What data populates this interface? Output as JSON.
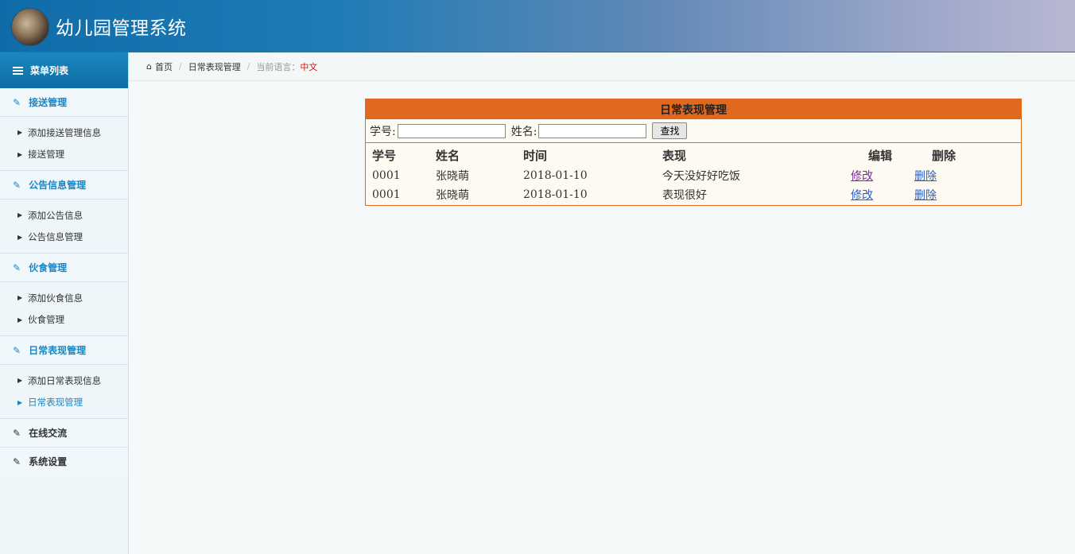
{
  "header": {
    "title": "幼儿园管理系统"
  },
  "sidebar": {
    "menu_title": "菜单列表",
    "groups": [
      {
        "title": "接送管理",
        "items": [
          "添加接送管理信息",
          "接送管理"
        ]
      },
      {
        "title": "公告信息管理",
        "items": [
          "添加公告信息",
          "公告信息管理"
        ]
      },
      {
        "title": "伙食管理",
        "items": [
          "添加伙食信息",
          "伙食管理"
        ]
      },
      {
        "title": "日常表现管理",
        "items": [
          "添加日常表现信息",
          "日常表现管理"
        ]
      }
    ],
    "extra": [
      "在线交流",
      "系统设置"
    ],
    "active_item": "日常表现管理"
  },
  "breadcrumb": {
    "home": "首页",
    "current": "日常表现管理",
    "lang_label": "当前语言：",
    "lang_value": "中文"
  },
  "panel": {
    "title": "日常表现管理",
    "search": {
      "id_label": "学号:",
      "name_label": "姓名:",
      "id_value": "",
      "name_value": "",
      "button": "查找"
    },
    "columns": [
      "学号",
      "姓名",
      "时间",
      "表现",
      "编辑",
      "删除"
    ],
    "rows": [
      {
        "id": "0001",
        "name": "张晓萌",
        "date": "2018-01-10",
        "performance": "今天没好好吃饭",
        "edit": "修改",
        "delete": "删除"
      },
      {
        "id": "0001",
        "name": "张晓萌",
        "date": "2018-01-10",
        "performance": "表现很好",
        "edit": "修改",
        "delete": "删除"
      }
    ]
  },
  "colors": {
    "header": "#0f6ca8",
    "accent": "#1a86c4",
    "panel_title": "#e1691f"
  }
}
